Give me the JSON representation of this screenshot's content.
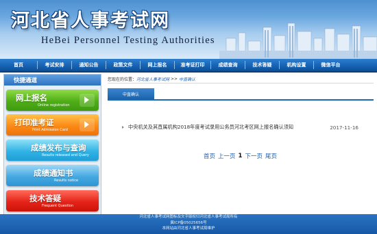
{
  "header": {
    "title": "河北省人事考试网",
    "subtitle": "HeBei  Personnel  Testing  Authorities"
  },
  "nav": {
    "items": [
      "首页",
      "考试安排",
      "通知公告",
      "政策文件",
      "网上报名",
      "准考证打印",
      "成绩查询",
      "技术答疑",
      "机构设置",
      "微信平台"
    ]
  },
  "sidebar": {
    "title": "快捷通道",
    "buttons": [
      {
        "label": "网上报名",
        "sub": "Online registration",
        "color": "#4fae17"
      },
      {
        "label": "打印准考证",
        "sub": "Print Admission Card",
        "color": "#fb8a16"
      },
      {
        "label": "成绩发布与查询",
        "sub": "Results released and Query",
        "color": "#32b3e6"
      },
      {
        "label": "成绩通知书",
        "sub": "Results  notice",
        "color": "#45a9e2"
      },
      {
        "label": "技术答疑",
        "sub": "Frequent Question",
        "color": "#e5241a"
      }
    ]
  },
  "breadcrumb": {
    "prefix": "您现在的位置：",
    "home": "河北省人事考试网",
    "sep": ">>",
    "current": "中直确认"
  },
  "tab": {
    "label": "中直确认"
  },
  "articles": [
    {
      "title": "中央机关及其直属机构2018年度考试录用公务员河北考区网上报名确认须知",
      "date": "2017-11-16"
    }
  ],
  "pager": {
    "first": "首页",
    "prev": "上一页",
    "current": "1",
    "next": "下一页",
    "last": "尾页"
  },
  "footer": {
    "lines": [
      "河北省人事考试网图标及文字版权归河北省人事考试局所有",
      "冀ICP备05025656号",
      "本网站由河北省人事考试局维护"
    ]
  }
}
